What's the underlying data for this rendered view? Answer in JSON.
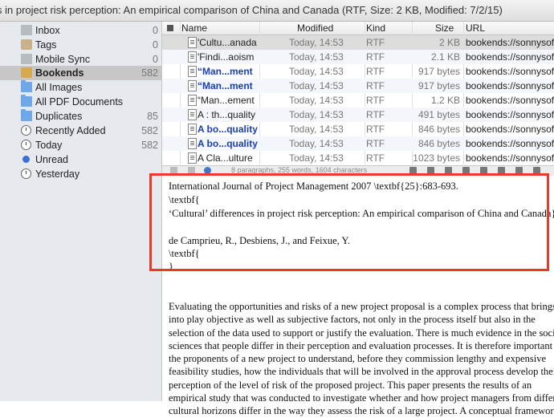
{
  "window": {
    "title": "s in project risk perception: An empirical comparison of China and Canada (RTF, Size: 2 KB, Modified: 7/2/15)"
  },
  "sidebar": {
    "items": [
      {
        "label": "Inbox",
        "count": "0",
        "icon": "folder-icon"
      },
      {
        "label": "Tags",
        "count": "0",
        "icon": "tag-icon"
      },
      {
        "label": "Mobile Sync",
        "count": "0",
        "icon": "folder-icon"
      },
      {
        "label": "Bookends",
        "count": "582",
        "icon": "library-icon",
        "selected": true
      },
      {
        "label": "All Images",
        "count": "",
        "icon": "folder-icon"
      },
      {
        "label": "All PDF Documents",
        "count": "",
        "icon": "folder-icon"
      },
      {
        "label": "Duplicates",
        "count": "85",
        "icon": "folder-icon"
      },
      {
        "label": "Recently Added",
        "count": "582",
        "icon": "clock-icon"
      },
      {
        "label": "Today",
        "count": "582",
        "icon": "clock-icon"
      },
      {
        "label": "Unread",
        "count": "",
        "icon": "dot-icon"
      },
      {
        "label": "Yesterday",
        "count": "",
        "icon": "clock-icon"
      }
    ]
  },
  "table": {
    "columns": [
      "Name",
      "Modified",
      "Kind",
      "Size",
      "URL"
    ],
    "rows": [
      {
        "name": "'Cultu...anada",
        "modified": "Today, 14:53",
        "kind": "RTF",
        "size": "2 KB",
        "url": "bookends://sonnysof",
        "bold": false
      },
      {
        "name": "'Findi...aoism",
        "modified": "Today, 14:53",
        "kind": "RTF",
        "size": "2.1 KB",
        "url": "bookends://sonnysof",
        "bold": false
      },
      {
        "name": "“Man...ment",
        "modified": "Today, 14:53",
        "kind": "RTF",
        "size": "917 bytes",
        "url": "bookends://sonnysof",
        "bold": true
      },
      {
        "name": "“Man...ment",
        "modified": "Today, 14:53",
        "kind": "RTF",
        "size": "917 bytes",
        "url": "bookends://sonnysof",
        "bold": true
      },
      {
        "name": "“Man...ement",
        "modified": "Today, 14:53",
        "kind": "RTF",
        "size": "1.2 KB",
        "url": "bookends://sonnysof",
        "bold": false
      },
      {
        "name": "A : th...quality",
        "modified": "Today, 14:53",
        "kind": "RTF",
        "size": "491 bytes",
        "url": "bookends://sonnysof",
        "bold": false
      },
      {
        "name": "A bo...quality",
        "modified": "Today, 14:53",
        "kind": "RTF",
        "size": "846 bytes",
        "url": "bookends://sonnysof",
        "bold": true
      },
      {
        "name": "A bo...quality",
        "modified": "Today, 14:53",
        "kind": "RTF",
        "size": "846 bytes",
        "url": "bookends://sonnysof",
        "bold": true
      },
      {
        "name": "A Cla...ulture",
        "modified": "Today, 14:53",
        "kind": "RTF",
        "size": "1023 bytes",
        "url": "bookends://sonnysof",
        "bold": false
      }
    ]
  },
  "toolbar": {
    "status": "8 paragraphs, 255 words, 1604 characters"
  },
  "notes": {
    "lines": [
      "International Journal of Project Management 2007 \\textbf{25}:683-693.",
      "\\textbf{",
      "‘Cultural’ differences in project risk perception: An empirical comparison of China and Canada}",
      "",
      "de Camprieu, R., Desbiens, J., and Feixue, Y.",
      "\\textbf{",
      "}"
    ],
    "abstract": [
      "Evaluating the opportunities and risks of a new project proposal is a complex process that brings",
      "into play objective as well as subjective factors, not only in the process itself but also in the",
      "selection of the data used to support or justify the evaluation. There is much evidence in the social",
      "sciences that people differ in their perception and evaluation processes. It is therefore important for",
      "the proponents of a new project to understand, before they commission lengthy and expensive",
      "feasibility studies, how the individuals that will be involved in the approval process develop their",
      "perception of the level of risk of the proposed project. This paper presents the results of an",
      "empirical study that was conducted to investigate whether and how project managers from different",
      "cultural horizons differ in the way they assess the risk of a large project. A conceptual framework"
    ]
  }
}
